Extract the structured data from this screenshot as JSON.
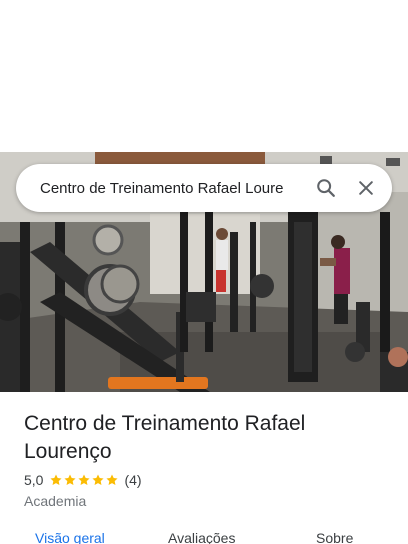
{
  "search": {
    "query": "Centro de Treinamento Rafael Loure",
    "search_icon": "search-icon",
    "close_icon": "close-icon"
  },
  "place": {
    "title": "Centro de Treinamento Rafael Lourenço",
    "rating": "5,0",
    "stars": 5,
    "review_count": "(4)",
    "category": "Academia",
    "photo": "gym-interior-photo"
  },
  "tabs": [
    {
      "label": "Visão geral",
      "active": true
    },
    {
      "label": "Avaliações",
      "active": false
    },
    {
      "label": "Sobre",
      "active": false
    }
  ],
  "colors": {
    "accent": "#1a73e8",
    "star": "#fbbc04",
    "text_primary": "#202124",
    "text_secondary": "#70757a"
  }
}
